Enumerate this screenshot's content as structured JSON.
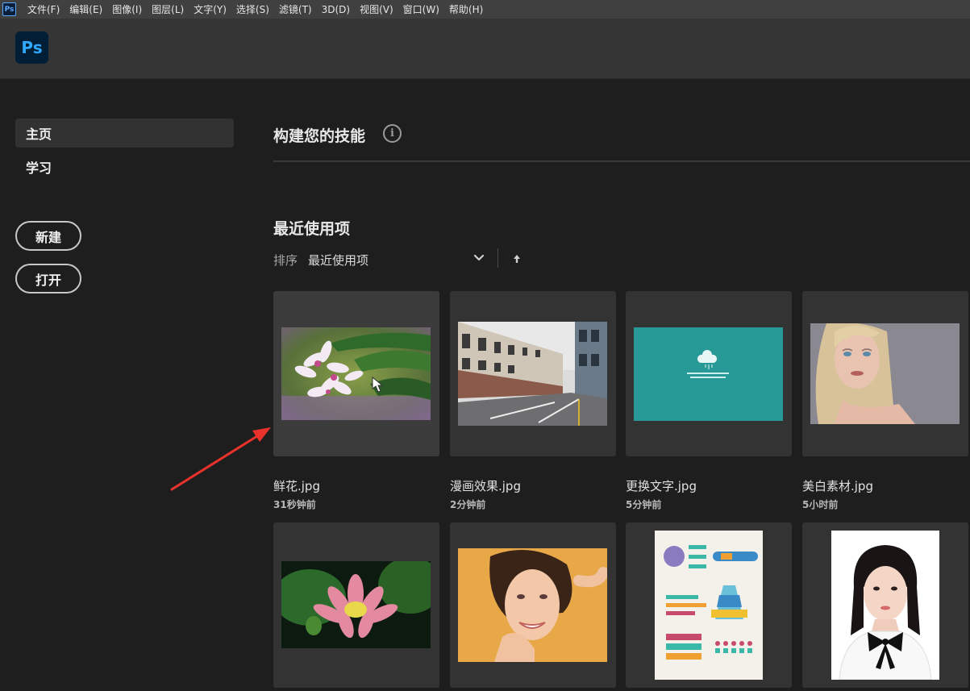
{
  "menubar": {
    "app_icon": "Ps",
    "items": [
      "文件(F)",
      "编辑(E)",
      "图像(I)",
      "图层(L)",
      "文字(Y)",
      "选择(S)",
      "滤镜(T)",
      "3D(D)",
      "视图(V)",
      "窗口(W)",
      "帮助(H)"
    ]
  },
  "header": {
    "logo": "Ps"
  },
  "sidebar": {
    "nav": [
      "主页",
      "学习"
    ],
    "new_button": "新建",
    "open_button": "打开"
  },
  "main": {
    "skills_title": "构建您的技能",
    "info_icon": "i",
    "recent_title": "最近使用项",
    "sort_label": "排序",
    "sort_value": "最近使用项"
  },
  "recent_files": [
    {
      "name": "鲜花.jpg",
      "time": "31秒钟前"
    },
    {
      "name": "漫画效果.jpg",
      "time": "2分钟前"
    },
    {
      "name": "更换文字.jpg",
      "time": "5分钟前"
    },
    {
      "name": "美白素材.jpg",
      "time": "5小时前"
    }
  ],
  "colors": {
    "accent": "#31a8ff",
    "annotation_arrow": "#e8322b",
    "card": "#333333",
    "background": "#1e1e1e"
  }
}
